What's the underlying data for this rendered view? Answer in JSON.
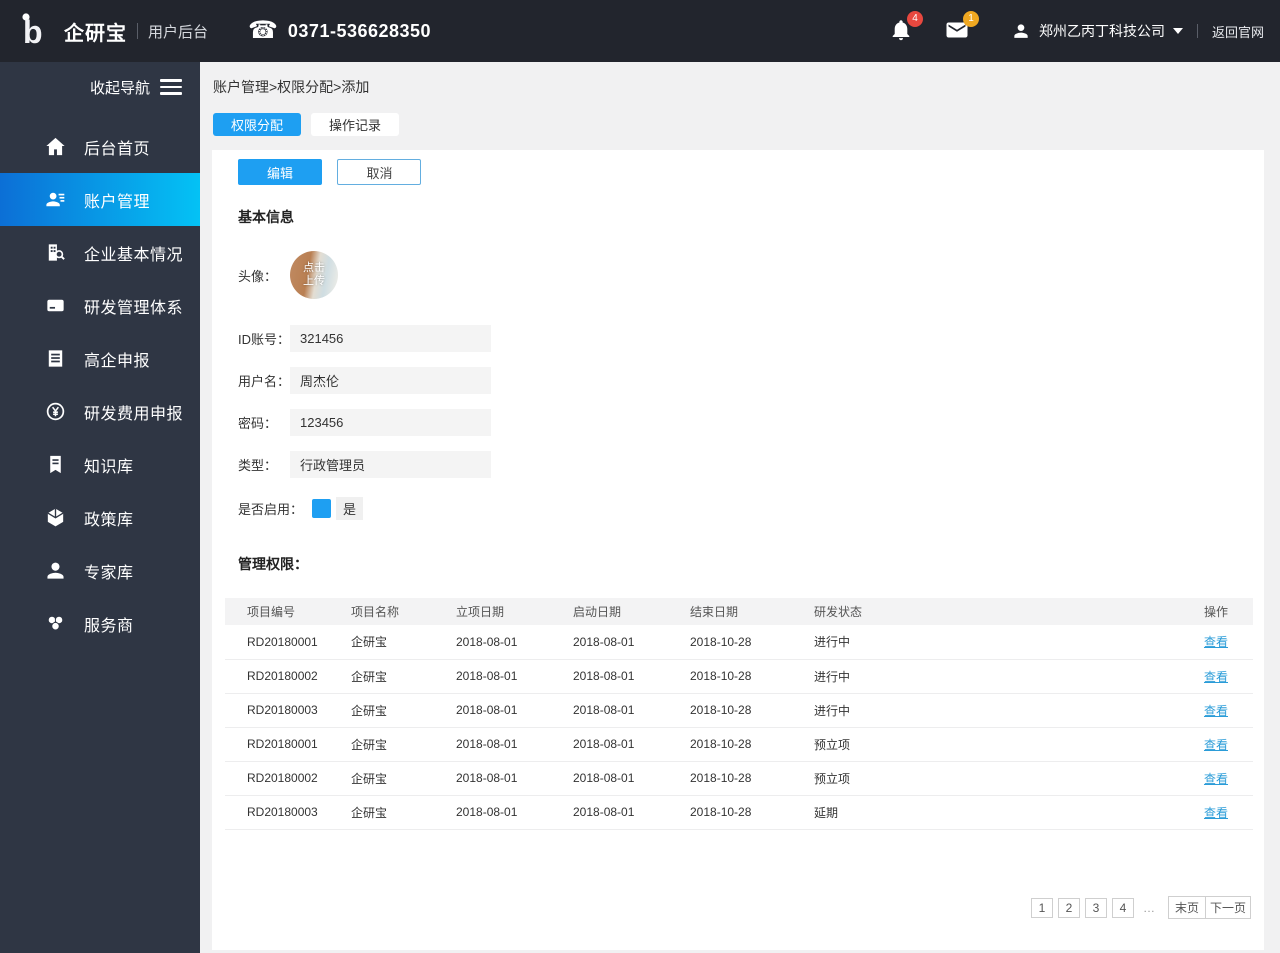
{
  "header": {
    "app_name": "企研宝",
    "portal_name": "用户后台",
    "phone": "0371-536628350",
    "bell_badge": "4",
    "mail_badge": "1",
    "company": "郑州乙丙丁科技公司",
    "back_link": "返回官网"
  },
  "sidebar": {
    "collapse_label": "收起导航",
    "items": [
      {
        "label": "后台首页",
        "icon": "home-icon",
        "active": false
      },
      {
        "label": "账户管理",
        "icon": "account-icon",
        "active": true
      },
      {
        "label": "企业基本情况",
        "icon": "company-icon",
        "active": false
      },
      {
        "label": "研发管理体系",
        "icon": "rd-system-icon",
        "active": false
      },
      {
        "label": "高企申报",
        "icon": "declare-icon",
        "active": false
      },
      {
        "label": "研发费用申报",
        "icon": "fee-icon",
        "active": false
      },
      {
        "label": "知识库",
        "icon": "knowledge-icon",
        "active": false
      },
      {
        "label": "政策库",
        "icon": "policy-icon",
        "active": false
      },
      {
        "label": "专家库",
        "icon": "expert-icon",
        "active": false
      },
      {
        "label": "服务商",
        "icon": "service-icon",
        "active": false
      }
    ]
  },
  "breadcrumb": "账户管理>权限分配>添加",
  "tabs": [
    {
      "label": "权限分配",
      "active": true
    },
    {
      "label": "操作记录",
      "active": false
    }
  ],
  "actions": {
    "edit": "编辑",
    "cancel": "取消"
  },
  "form": {
    "section_title": "基本信息",
    "avatar_label": "头像：",
    "avatar_text": "点击上传",
    "fields": [
      {
        "name": "id-account",
        "label": "ID账号：",
        "value": "321456"
      },
      {
        "name": "username",
        "label": "用户名：",
        "value": "周杰伦"
      },
      {
        "name": "password",
        "label": "密码：",
        "value": "123456"
      },
      {
        "name": "type",
        "label": "类型：",
        "value": "行政管理员"
      }
    ],
    "enable_label": "是否启用：",
    "enable_checked": true,
    "enable_value": "是"
  },
  "permissions": {
    "section_title": "管理权限：",
    "table": {
      "headers": [
        "项目编号",
        "项目名称",
        "立项日期",
        "启动日期",
        "结束日期",
        "研发状态",
        "操作"
      ],
      "action_label": "查看",
      "rows": [
        [
          "RD20180001",
          "企研宝",
          "2018-08-01",
          "2018-08-01",
          "2018-10-28",
          "进行中"
        ],
        [
          "RD20180002",
          "企研宝",
          "2018-08-01",
          "2018-08-01",
          "2018-10-28",
          "进行中"
        ],
        [
          "RD20180003",
          "企研宝",
          "2018-08-01",
          "2018-08-01",
          "2018-10-28",
          "进行中"
        ],
        [
          "RD20180001",
          "企研宝",
          "2018-08-01",
          "2018-08-01",
          "2018-10-28",
          "预立项"
        ],
        [
          "RD20180002",
          "企研宝",
          "2018-08-01",
          "2018-08-01",
          "2018-10-28",
          "预立项"
        ],
        [
          "RD20180003",
          "企研宝",
          "2018-08-01",
          "2018-08-01",
          "2018-10-28",
          "延期"
        ]
      ]
    }
  },
  "pagination": {
    "pages": [
      "1",
      "2",
      "3",
      "4"
    ],
    "ellipsis": "…",
    "last_label": "末页",
    "next_label": "下一页"
  },
  "colors": {
    "accent": "#1e9ff2",
    "link": "#2b9cd8",
    "header_bg": "#22252d",
    "sidebar_bg": "#2f3644",
    "badge_red": "#e8483f",
    "badge_yellow": "#f0a821",
    "active_gradient_start": "#0c6fd6",
    "active_gradient_end": "#04c2f5"
  }
}
